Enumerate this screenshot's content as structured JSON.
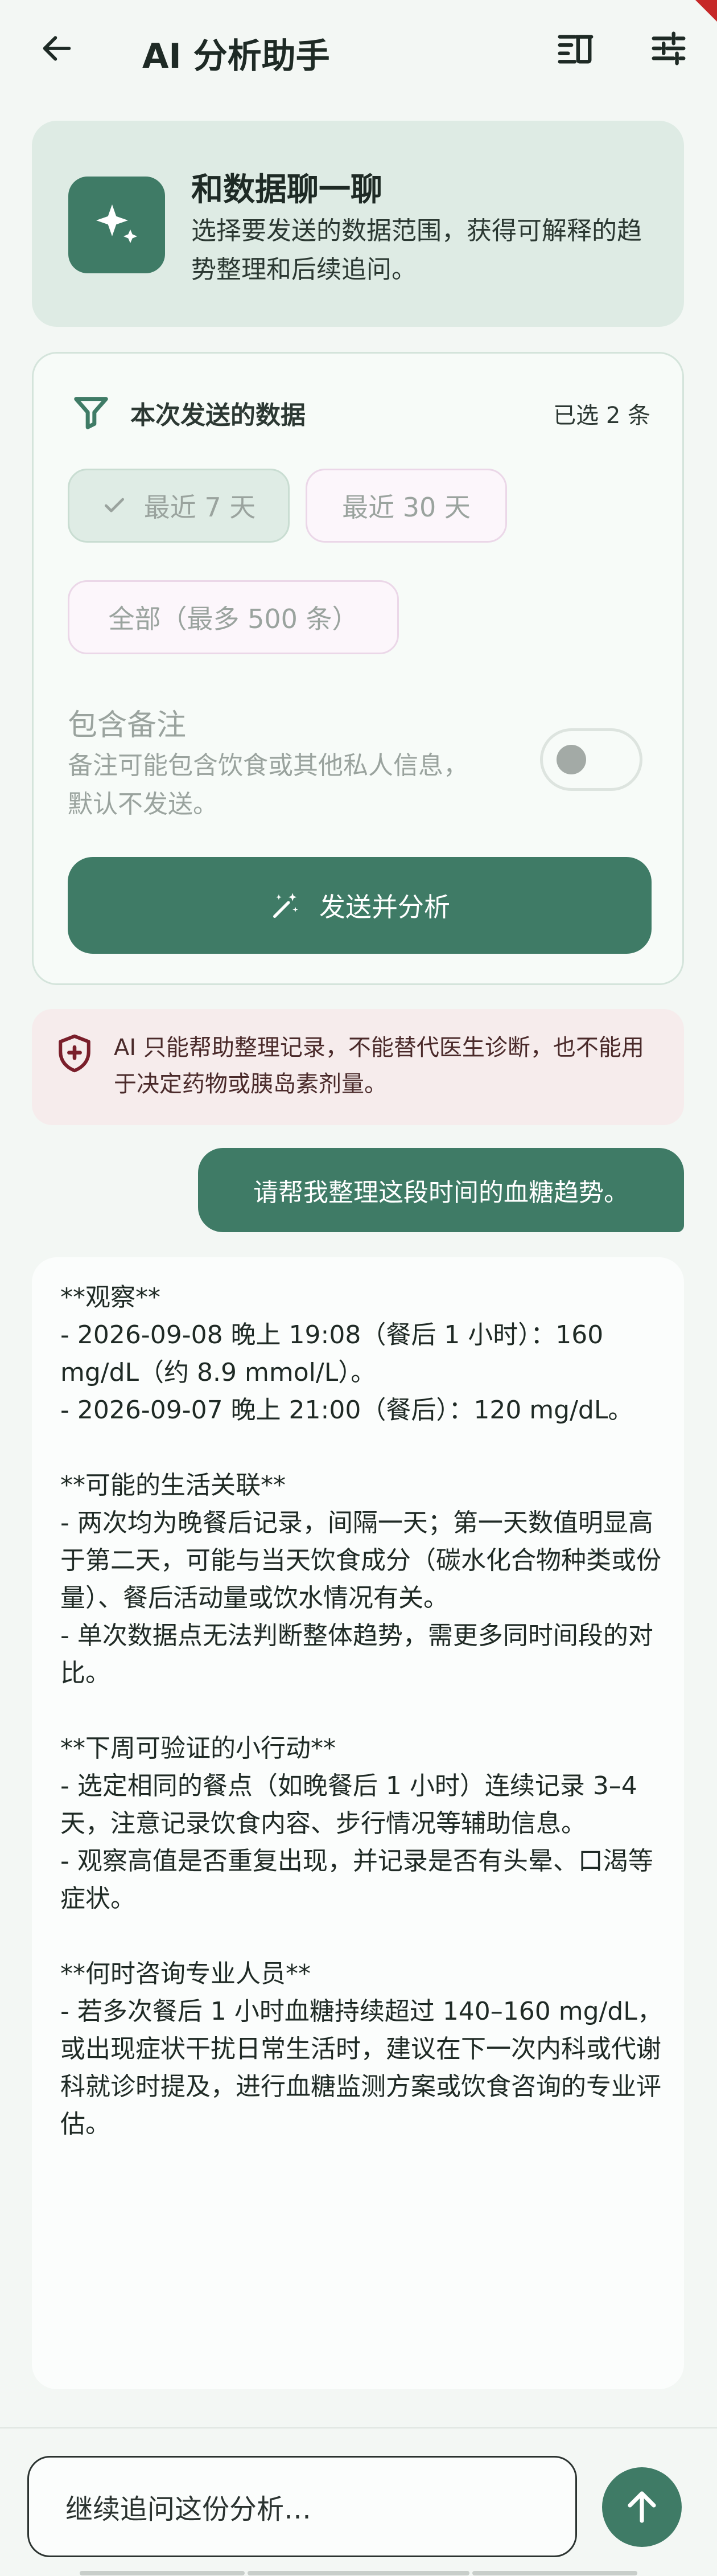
{
  "appbar": {
    "title": "AI 分析助手"
  },
  "hero": {
    "title": "和数据聊一聊",
    "subtitle": "选择要发送的数据范围，获得可解释的趋势整理和后续追问。"
  },
  "selection": {
    "title": "本次发送的数据",
    "count": "已选 2 条",
    "chips": {
      "last7": "最近 7 天",
      "last30": "最近 30 天",
      "all": "全部（最多 500 条）"
    },
    "selected_chip": "最近 7 天",
    "notes_label": "包含备注",
    "notes_desc": "备注可能包含饮食或其他私人信息，默认不发送。",
    "notes_toggle_on": false,
    "send_label": "发送并分析"
  },
  "disclaimer": "AI 只能帮助整理记录，不能替代医生诊断，也不能用于决定药物或胰岛素剂量。",
  "messages": {
    "user": "请帮我整理这段时间的血糖趋势。",
    "ai": "**观察**\n- 2026-09-08 晚上 19:08（餐后 1 小时）：160 mg/dL（约 8.9 mmol/L）。\n- 2026-09-07 晚上 21:00（餐后）：120 mg/dL。\n\n**可能的生活关联**\n- 两次均为晚餐后记录，间隔一天；第一天数值明显高于第二天，可能与当天饮食成分（碳水化合物种类或份量）、餐后活动量或饮水情况有关。\n- 单次数据点无法判断整体趋势，需更多同时间段的对比。\n\n**下周可验证的小行动**\n- 选定相同的餐点（如晚餐后 1 小时）连续记录 3–4 天，注意记录饮食内容、步行情况等辅助信息。\n- 观察高值是否重复出现，并记录是否有头晕、口渴等症状。\n\n**何时咨询专业人员**\n- 若多次餐后 1 小时血糖持续超过 140–160 mg/dL，或出现症状干扰日常生活时，建议在下一次内科或代谢科就诊时提及，进行血糖监测方案或饮食咨询的专业评估。"
  },
  "composer": {
    "placeholder": "继续追问这份分析…"
  },
  "colors": {
    "primary": "#3f7b66",
    "background": "#f3f7f4",
    "hero_bg": "#deebe4",
    "warning_bg": "#f6ecec",
    "warning_icon": "#7a1f2b"
  },
  "icons": {
    "back": "arrow-left-icon",
    "sort": "clear-sort-icon",
    "tune": "sliders-icon",
    "hero": "sparkles-icon",
    "filter": "filter-icon",
    "check": "check-icon",
    "send": "magic-wand-icon",
    "warning": "shield-plus-icon",
    "fab": "arrow-up-icon"
  }
}
